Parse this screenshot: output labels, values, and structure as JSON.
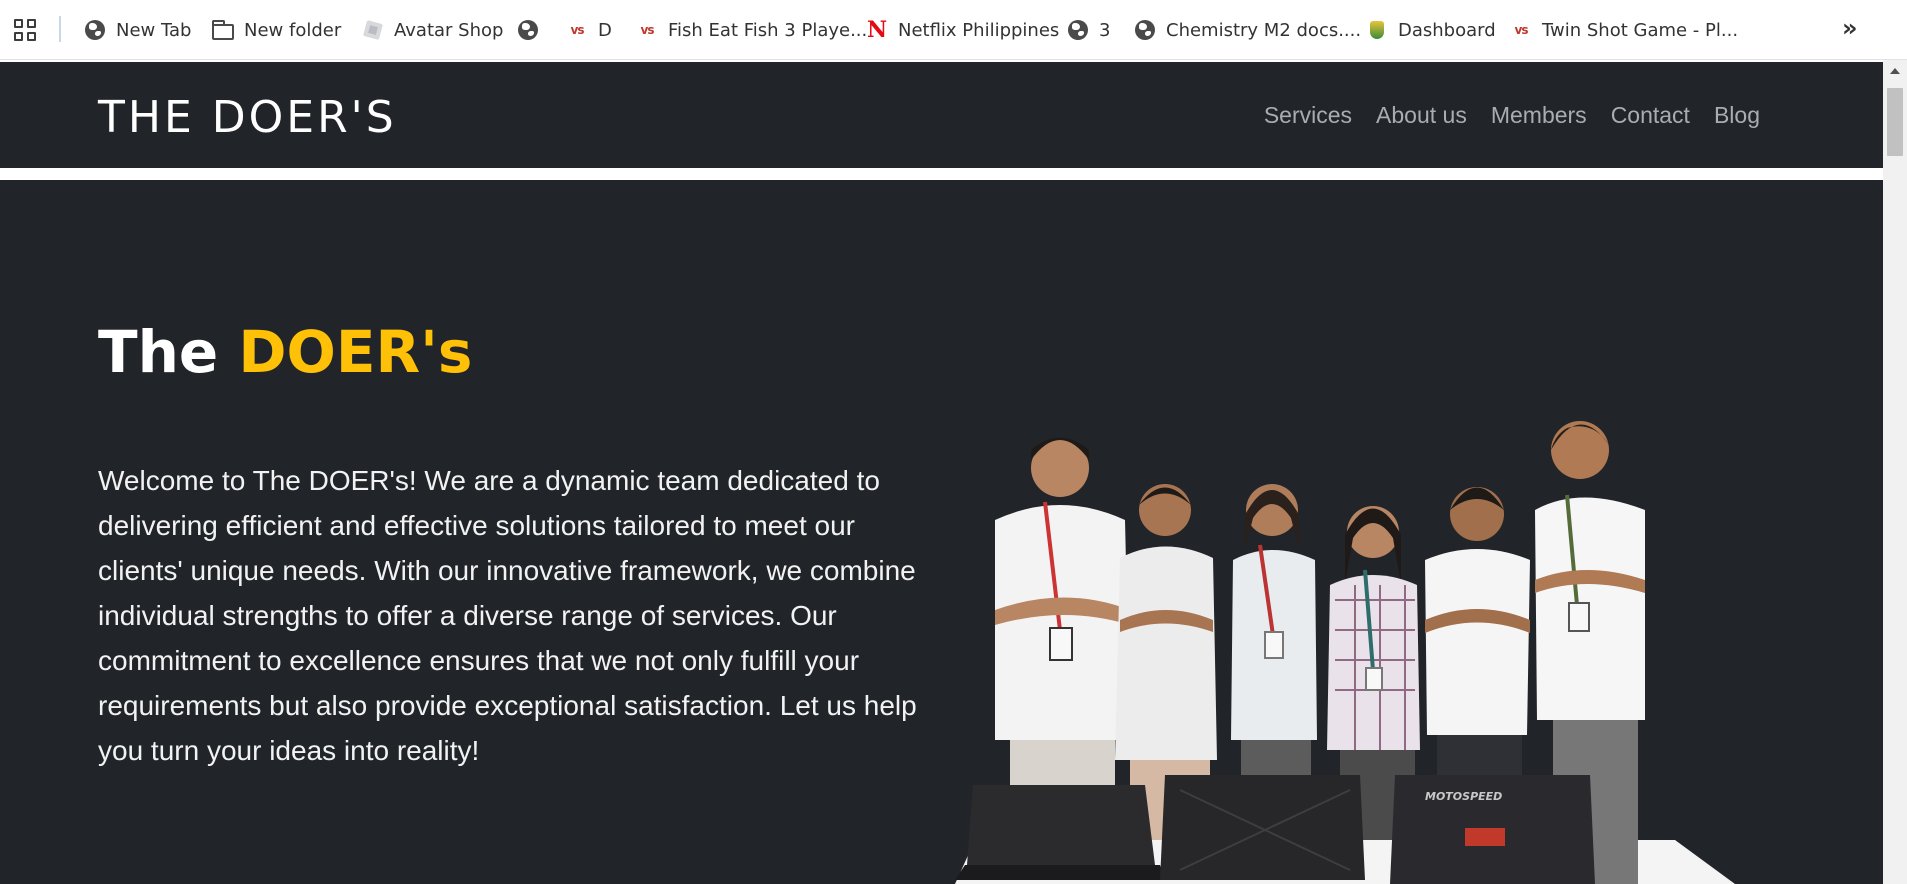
{
  "bookmarks": {
    "items": [
      {
        "label": "New Tab",
        "icon": "globe-icon"
      },
      {
        "label": "New folder",
        "icon": "folder-icon"
      },
      {
        "label": "Avatar Shop",
        "icon": "roblox-icon"
      },
      {
        "label": "",
        "icon": "globe-icon"
      },
      {
        "label": "D",
        "icon": "vs-icon"
      },
      {
        "label": "Fish Eat Fish 3 Playe...",
        "icon": "vs-icon"
      },
      {
        "label": "Netflix Philippines",
        "icon": "netflix-icon"
      },
      {
        "label": "3",
        "icon": "globe-icon"
      },
      {
        "label": "Chemistry M2 docs....",
        "icon": "globe-icon"
      },
      {
        "label": "Dashboard",
        "icon": "shield-icon"
      },
      {
        "label": "Twin Shot Game - Pl...",
        "icon": "vs-icon"
      }
    ],
    "vs_glyph": "vs",
    "netflix_glyph": "N",
    "more_glyph": "»"
  },
  "header": {
    "brand": "THE DOER'S",
    "nav": [
      "Services",
      "About us",
      "Members",
      "Contact",
      "Blog"
    ]
  },
  "hero": {
    "title_plain": "The ",
    "title_accent": "DOER's",
    "body": "Welcome to The DOER's! We are a dynamic team dedicated to delivering efficient and effective solutions tailored to meet our clients' unique needs. With our innovative framework, we combine individual strengths to offer a diverse range of services. Our commitment to excellence ensures that we not only fulfill your requirements but also provide exceptional satisfaction. Let us help you turn your ideas into reality!",
    "laptop_label": "MOTOSPEED"
  },
  "colors": {
    "header_bg": "#212529",
    "accent": "#ffc107",
    "nav_text": "#a9adb2"
  }
}
